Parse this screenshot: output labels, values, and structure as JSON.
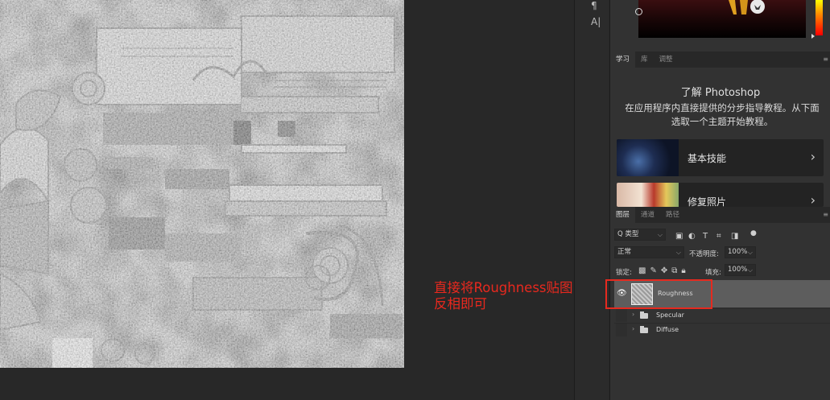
{
  "annotation": {
    "line1": "直接将Roughness贴图",
    "line2": "反相即可"
  },
  "toolstrip": {
    "tools": [
      {
        "icon": "paragraph-icon",
        "glyph": "¶"
      },
      {
        "icon": "character-icon",
        "glyph": "A|"
      }
    ]
  },
  "learn_tabs": [
    {
      "label": "学习",
      "active": true
    },
    {
      "label": "库",
      "active": false
    },
    {
      "label": "调整",
      "active": false
    }
  ],
  "learn": {
    "title": "了解 Photoshop",
    "description": "在应用程序内直接提供的分步指导教程。从下面选取一个主题开始教程。",
    "cards": [
      {
        "label": "基本技能",
        "arrow": "›"
      },
      {
        "label": "修复照片",
        "arrow": "›"
      }
    ]
  },
  "layer_tabs": [
    {
      "label": "图层",
      "active": true
    },
    {
      "label": "通道",
      "active": false
    },
    {
      "label": "路径",
      "active": false
    }
  ],
  "layers_panel": {
    "filter_label": "Q 类型",
    "blend_mode": "正常",
    "opacity_label": "不透明度:",
    "opacity_value": "100%",
    "lock_label": "锁定:",
    "fill_label": "填充:",
    "fill_value": "100%",
    "layers": [
      {
        "name": "Roughness",
        "type": "image",
        "visible": true,
        "selected": true
      },
      {
        "name": "Specular",
        "type": "group",
        "visible": false,
        "selected": false
      },
      {
        "name": "Diffuse",
        "type": "group",
        "visible": false,
        "selected": false
      }
    ]
  },
  "colors": {
    "annotation_red": "#e8281e",
    "panel_bg": "#323232",
    "selected_layer": "#5d5d5d"
  }
}
